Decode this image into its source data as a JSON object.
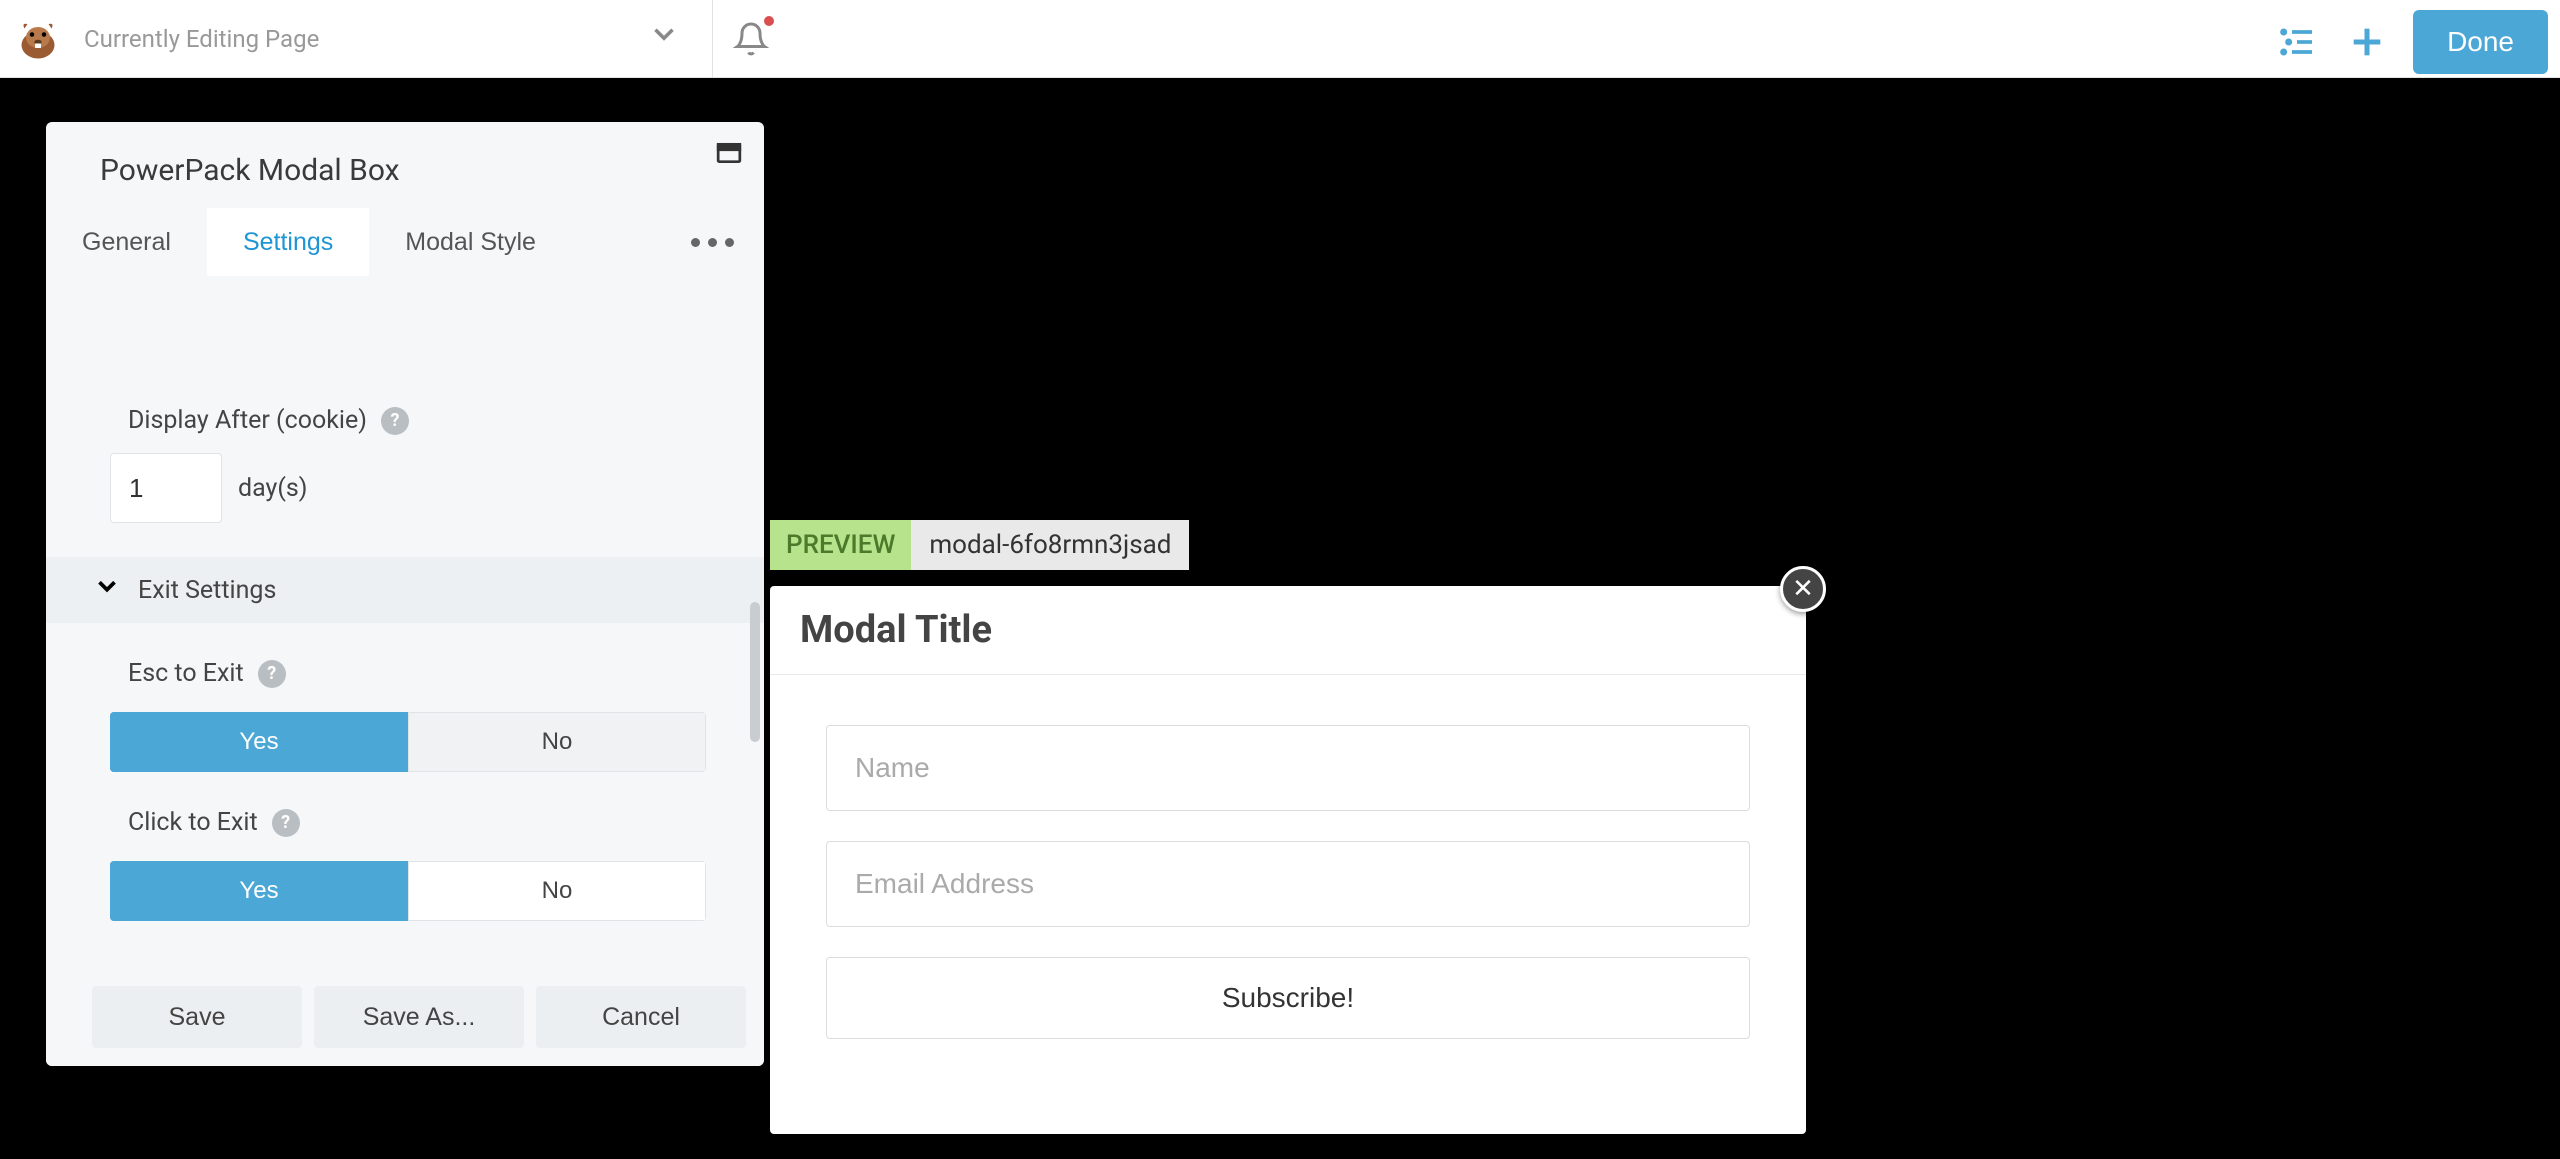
{
  "header": {
    "page_title": "Currently Editing Page",
    "done_label": "Done"
  },
  "panel": {
    "title": "PowerPack Modal Box",
    "tabs": {
      "general": "General",
      "settings": "Settings",
      "modal_style": "Modal Style"
    },
    "fields": {
      "display_after_label": "Display After (cookie)",
      "display_after_value": "1",
      "display_after_unit": "day(s)",
      "exit_section": "Exit Settings",
      "esc_label": "Esc to Exit",
      "click_label": "Click to Exit"
    },
    "toggle": {
      "yes": "Yes",
      "no": "No"
    },
    "footer": {
      "save": "Save",
      "save_as": "Save As...",
      "cancel": "Cancel"
    }
  },
  "preview": {
    "badge": "PREVIEW",
    "id": "modal-6fo8rmn3jsad",
    "modal_title": "Modal Title",
    "name_placeholder": "Name",
    "email_placeholder": "Email Address",
    "subscribe": "Subscribe!"
  }
}
